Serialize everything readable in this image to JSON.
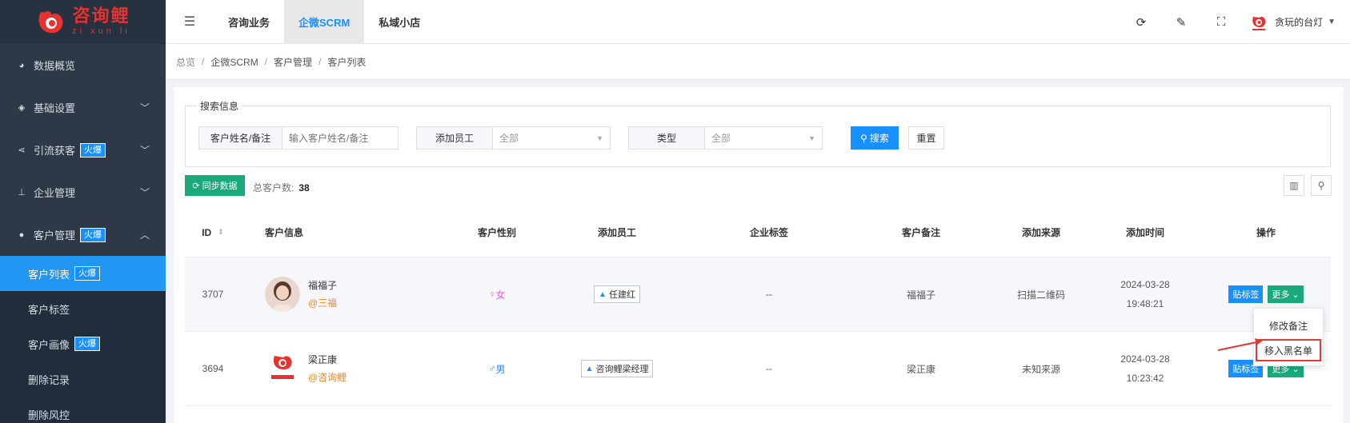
{
  "logo": {
    "cn": "咨询鲤",
    "pinyin": "zi xun li"
  },
  "sidebar": {
    "items": [
      {
        "label": "数据概览",
        "icon": "pie-chart-icon",
        "badge": "",
        "chevron": ""
      },
      {
        "label": "基础设置",
        "icon": "cube-icon",
        "badge": "",
        "chevron": "﹀"
      },
      {
        "label": "引流获客",
        "icon": "share-icon",
        "badge": "火爆",
        "chevron": "﹀"
      },
      {
        "label": "企业管理",
        "icon": "sitemap-icon",
        "badge": "",
        "chevron": "﹀"
      },
      {
        "label": "客户管理",
        "icon": "user-icon",
        "badge": "火爆",
        "chevron": "︿"
      }
    ],
    "subitems": [
      {
        "label": "客户列表",
        "badge": "火爆",
        "active": true
      },
      {
        "label": "客户标签",
        "badge": ""
      },
      {
        "label": "客户画像",
        "badge": "火爆"
      },
      {
        "label": "删除记录",
        "badge": ""
      },
      {
        "label": "删除风控",
        "badge": ""
      }
    ]
  },
  "header": {
    "tabs": [
      "咨询业务",
      "企微SCRM",
      "私域小店"
    ],
    "active_tab": 1,
    "user_name": "贪玩的台灯"
  },
  "breadcrumb": [
    "总览",
    "企微SCRM",
    "客户管理",
    "客户列表"
  ],
  "search": {
    "legend": "搜索信息",
    "name_label": "客户姓名/备注",
    "name_placeholder": "输入客户姓名/备注",
    "staff_label": "添加员工",
    "staff_value": "全部",
    "type_label": "类型",
    "type_value": "全部",
    "search_button": "搜索",
    "reset_button": "重置"
  },
  "toolbar": {
    "sync_button": "同步数据",
    "total_label": "总客户数:",
    "total_count": "38"
  },
  "table": {
    "headers": [
      "ID",
      "客户信息",
      "客户性别",
      "添加员工",
      "企业标签",
      "客户备注",
      "添加来源",
      "添加时间",
      "操作"
    ],
    "rows": [
      {
        "id": "3707",
        "name": "福福子",
        "corp": "@三福",
        "gender": "女",
        "gender_type": "female",
        "staff": "任建红",
        "tag": "--",
        "remark": "福福子",
        "source": "扫描二维码",
        "date": "2024-03-28",
        "time": "19:48:21",
        "tag_button": "贴标签",
        "more_button": "更多"
      },
      {
        "id": "3694",
        "name": "梁正康",
        "corp": "@咨询鲤",
        "gender": "男",
        "gender_type": "male",
        "staff": "咨询鲤梁经理",
        "tag": "--",
        "remark": "梁正康",
        "source": "未知来源",
        "date": "2024-03-28",
        "time": "10:23:42",
        "tag_button": "贴标签",
        "more_button": "更多"
      }
    ]
  },
  "dropdown": {
    "items": [
      "修改备注",
      "移入黑名单"
    ]
  },
  "colors": {
    "primary": "#1890ff",
    "success": "#19a97b",
    "sidebar": "#2e3846",
    "brand_red": "#e8322f",
    "annotation_red": "#e53935"
  }
}
